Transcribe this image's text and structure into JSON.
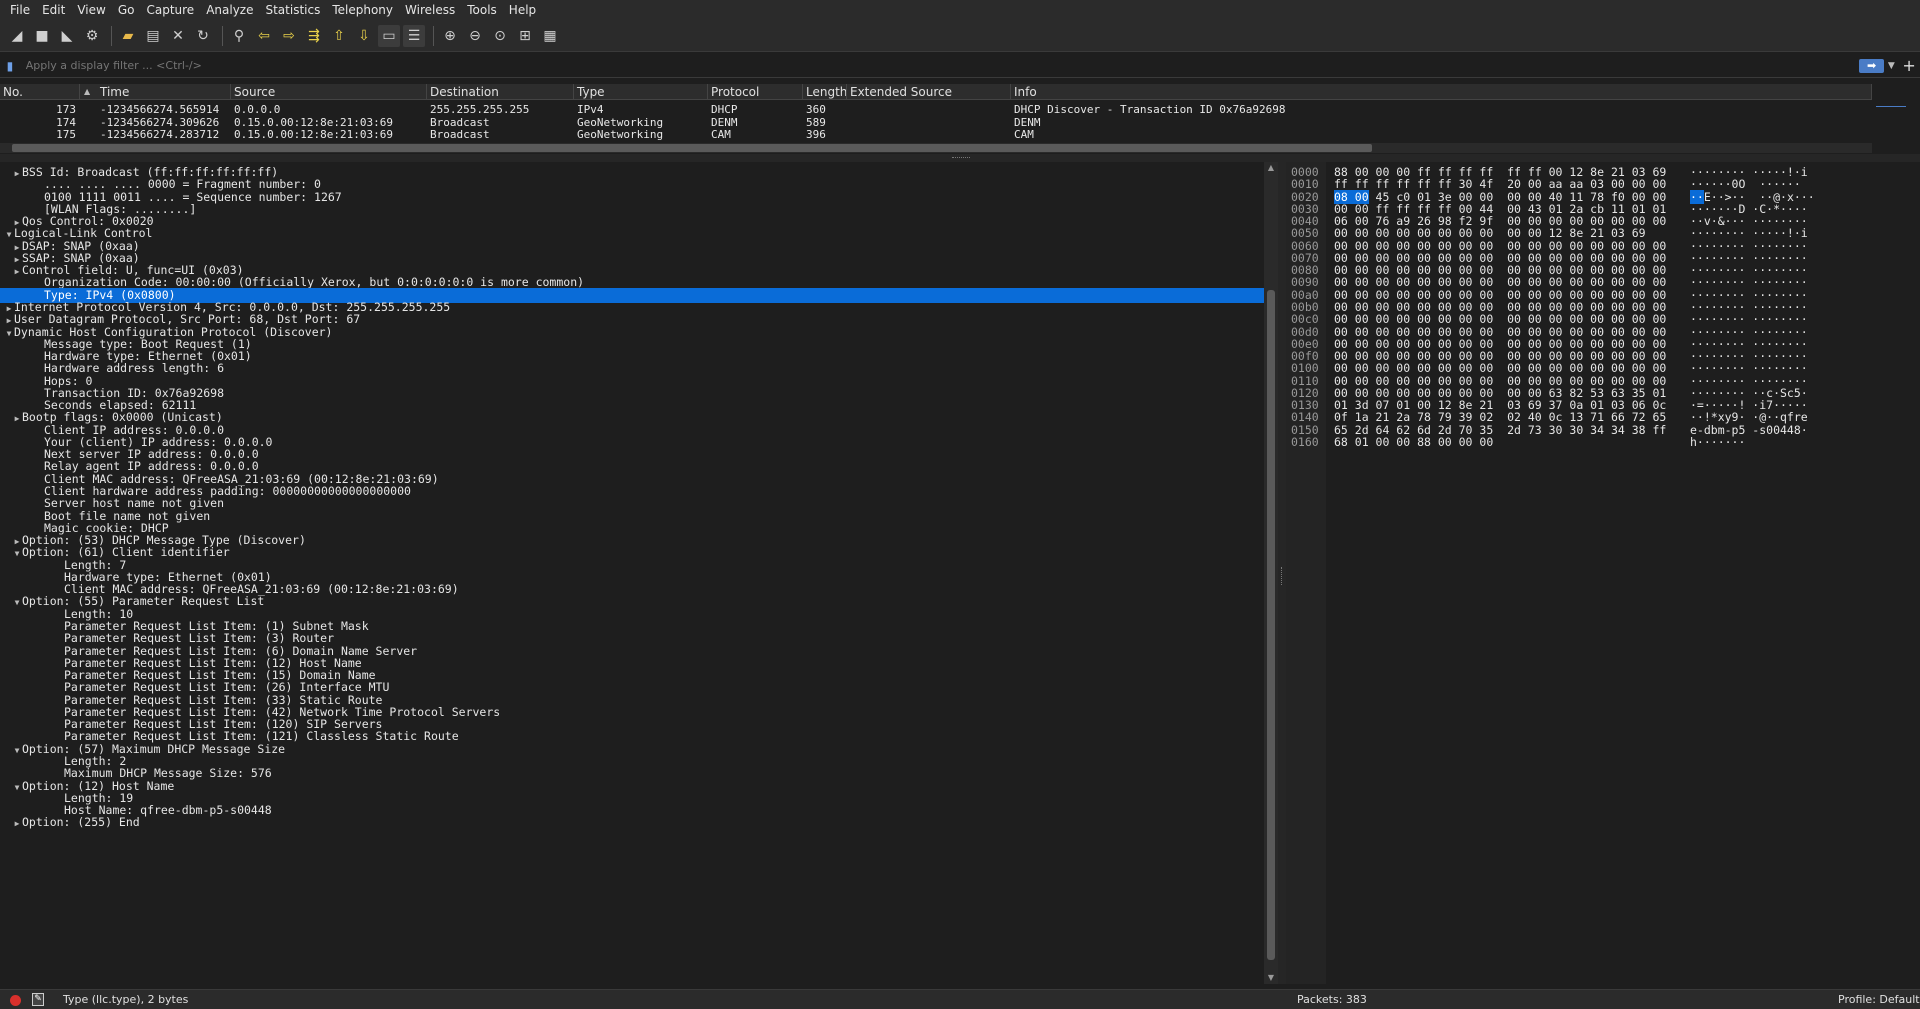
{
  "menu": [
    "File",
    "Edit",
    "View",
    "Go",
    "Capture",
    "Analyze",
    "Statistics",
    "Telephony",
    "Wireless",
    "Tools",
    "Help"
  ],
  "toolbar_icons": [
    "start-capture-icon",
    "stop-capture-icon",
    "restart-capture-icon",
    "capture-options-icon",
    "open-file-icon",
    "save-file-icon",
    "close-file-icon",
    "reload-file-icon",
    "find-packet-icon",
    "go-back-icon",
    "go-forward-icon",
    "go-to-packet-icon",
    "go-first-icon",
    "go-last-icon",
    "autoscroll-icon",
    "colorize-icon",
    "zoom-in-icon",
    "zoom-out-icon",
    "zoom-normal-icon",
    "resize-columns-icon",
    "layout-icon"
  ],
  "filter": {
    "placeholder": "Apply a display filter ... <Ctrl-/>"
  },
  "packet_list": {
    "columns": [
      "No.",
      "Time",
      "Source",
      "Destination",
      "Type",
      "Protocol",
      "Length",
      "Extended Source",
      "Info"
    ],
    "rows": [
      {
        "no": "173",
        "time": "-1234566274.565914",
        "source": "0.0.0.0",
        "destination": "255.255.255.255",
        "type": "IPv4",
        "protocol": "DHCP",
        "length": "360",
        "ext_source": "",
        "info": "DHCP Discover - Transaction ID 0x76a92698"
      },
      {
        "no": "174",
        "time": "-1234566274.309626",
        "source": "0.15.0.00:12:8e:21:03:69",
        "destination": "Broadcast",
        "type": "GeoNetworking",
        "protocol": "DENM",
        "length": "589",
        "ext_source": "",
        "info": "DENM"
      },
      {
        "no": "175",
        "time": "-1234566274.283712",
        "source": "0.15.0.00:12:8e:21:03:69",
        "destination": "Broadcast",
        "type": "GeoNetworking",
        "protocol": "CAM",
        "length": "396",
        "ext_source": "",
        "info": "CAM"
      }
    ]
  },
  "tree": [
    {
      "indent": 1,
      "arrow": "collapsed",
      "text": "BSS Id: Broadcast (ff:ff:ff:ff:ff:ff)"
    },
    {
      "indent": 2,
      "arrow": "",
      "text": ".... .... .... 0000 = Fragment number: 0"
    },
    {
      "indent": 2,
      "arrow": "",
      "text": "0100 1111 0011 .... = Sequence number: 1267"
    },
    {
      "indent": 2,
      "arrow": "",
      "text": "[WLAN Flags: ........]"
    },
    {
      "indent": 1,
      "arrow": "collapsed",
      "text": "Qos Control: 0x0020"
    },
    {
      "indent": 0,
      "arrow": "expanded",
      "text": "Logical-Link Control"
    },
    {
      "indent": 1,
      "arrow": "collapsed",
      "text": "DSAP: SNAP (0xaa)"
    },
    {
      "indent": 1,
      "arrow": "collapsed",
      "text": "SSAP: SNAP (0xaa)"
    },
    {
      "indent": 1,
      "arrow": "collapsed",
      "text": "Control field: U, func=UI (0x03)"
    },
    {
      "indent": 2,
      "arrow": "",
      "text": "Organization Code: 00:00:00 (Officially Xerox, but 0:0:0:0:0:0 is more common)"
    },
    {
      "indent": 2,
      "arrow": "",
      "text": "Type: IPv4 (0x0800)",
      "selected": true
    },
    {
      "indent": 0,
      "arrow": "collapsed",
      "text": "Internet Protocol Version 4, Src: 0.0.0.0, Dst: 255.255.255.255"
    },
    {
      "indent": 0,
      "arrow": "collapsed",
      "text": "User Datagram Protocol, Src Port: 68, Dst Port: 67"
    },
    {
      "indent": 0,
      "arrow": "expanded",
      "text": "Dynamic Host Configuration Protocol (Discover)"
    },
    {
      "indent": 2,
      "arrow": "",
      "text": "Message type: Boot Request (1)"
    },
    {
      "indent": 2,
      "arrow": "",
      "text": "Hardware type: Ethernet (0x01)"
    },
    {
      "indent": 2,
      "arrow": "",
      "text": "Hardware address length: 6"
    },
    {
      "indent": 2,
      "arrow": "",
      "text": "Hops: 0"
    },
    {
      "indent": 2,
      "arrow": "",
      "text": "Transaction ID: 0x76a92698"
    },
    {
      "indent": 2,
      "arrow": "",
      "text": "Seconds elapsed: 62111"
    },
    {
      "indent": 1,
      "arrow": "collapsed",
      "text": "Bootp flags: 0x0000 (Unicast)"
    },
    {
      "indent": 2,
      "arrow": "",
      "text": "Client IP address: 0.0.0.0"
    },
    {
      "indent": 2,
      "arrow": "",
      "text": "Your (client) IP address: 0.0.0.0"
    },
    {
      "indent": 2,
      "arrow": "",
      "text": "Next server IP address: 0.0.0.0"
    },
    {
      "indent": 2,
      "arrow": "",
      "text": "Relay agent IP address: 0.0.0.0"
    },
    {
      "indent": 2,
      "arrow": "",
      "text": "Client MAC address: QFreeASA_21:03:69 (00:12:8e:21:03:69)"
    },
    {
      "indent": 2,
      "arrow": "",
      "text": "Client hardware address padding: 00000000000000000000"
    },
    {
      "indent": 2,
      "arrow": "",
      "text": "Server host name not given"
    },
    {
      "indent": 2,
      "arrow": "",
      "text": "Boot file name not given"
    },
    {
      "indent": 2,
      "arrow": "",
      "text": "Magic cookie: DHCP"
    },
    {
      "indent": 1,
      "arrow": "collapsed",
      "text": "Option: (53) DHCP Message Type (Discover)"
    },
    {
      "indent": 1,
      "arrow": "expanded",
      "text": "Option: (61) Client identifier"
    },
    {
      "indent": 3,
      "arrow": "",
      "text": "Length: 7"
    },
    {
      "indent": 3,
      "arrow": "",
      "text": "Hardware type: Ethernet (0x01)"
    },
    {
      "indent": 3,
      "arrow": "",
      "text": "Client MAC address: QFreeASA_21:03:69 (00:12:8e:21:03:69)"
    },
    {
      "indent": 1,
      "arrow": "expanded",
      "text": "Option: (55) Parameter Request List"
    },
    {
      "indent": 3,
      "arrow": "",
      "text": "Length: 10"
    },
    {
      "indent": 3,
      "arrow": "",
      "text": "Parameter Request List Item: (1) Subnet Mask"
    },
    {
      "indent": 3,
      "arrow": "",
      "text": "Parameter Request List Item: (3) Router"
    },
    {
      "indent": 3,
      "arrow": "",
      "text": "Parameter Request List Item: (6) Domain Name Server"
    },
    {
      "indent": 3,
      "arrow": "",
      "text": "Parameter Request List Item: (12) Host Name"
    },
    {
      "indent": 3,
      "arrow": "",
      "text": "Parameter Request List Item: (15) Domain Name"
    },
    {
      "indent": 3,
      "arrow": "",
      "text": "Parameter Request List Item: (26) Interface MTU"
    },
    {
      "indent": 3,
      "arrow": "",
      "text": "Parameter Request List Item: (33) Static Route"
    },
    {
      "indent": 3,
      "arrow": "",
      "text": "Parameter Request List Item: (42) Network Time Protocol Servers"
    },
    {
      "indent": 3,
      "arrow": "",
      "text": "Parameter Request List Item: (120) SIP Servers"
    },
    {
      "indent": 3,
      "arrow": "",
      "text": "Parameter Request List Item: (121) Classless Static Route"
    },
    {
      "indent": 1,
      "arrow": "expanded",
      "text": "Option: (57) Maximum DHCP Message Size"
    },
    {
      "indent": 3,
      "arrow": "",
      "text": "Length: 2"
    },
    {
      "indent": 3,
      "arrow": "",
      "text": "Maximum DHCP Message Size: 576"
    },
    {
      "indent": 1,
      "arrow": "expanded",
      "text": "Option: (12) Host Name"
    },
    {
      "indent": 3,
      "arrow": "",
      "text": "Length: 19"
    },
    {
      "indent": 3,
      "arrow": "",
      "text": "Host Name: qfree-dbm-p5-s00448"
    },
    {
      "indent": 1,
      "arrow": "collapsed",
      "text": "Option: (255) End"
    }
  ],
  "bytes": [
    {
      "off": "0000",
      "hex": "88 00 00 00 ff ff ff ff  ff ff 00 12 8e 21 03 69",
      "ascii": "········ ·····!·i"
    },
    {
      "off": "0010",
      "hex": "ff ff ff ff ff ff 30 4f  20 00 aa aa 03 00 00 00",
      "ascii": "······0O  ······"
    },
    {
      "off": "0020",
      "hex_pre": "",
      "hex_hl": "08 00",
      "hex_post": " 45 c0 01 3e 00 00  00 00 40 11 78 f0 00 00",
      "ascii_hl": "··",
      "ascii_post": "E··>··  ··@·x···"
    },
    {
      "off": "0030",
      "hex": "00 00 ff ff ff ff 00 44  00 43 01 2a cb 11 01 01",
      "ascii": "·······D ·C·*····"
    },
    {
      "off": "0040",
      "hex": "06 00 76 a9 26 98 f2 9f  00 00 00 00 00 00 00 00",
      "ascii": "··v·&··· ········"
    },
    {
      "off": "0050",
      "hex": "00 00 00 00 00 00 00 00  00 00 12 8e 21 03 69",
      "ascii": "········ ·····!·i"
    },
    {
      "off": "0060",
      "hex": "00 00 00 00 00 00 00 00  00 00 00 00 00 00 00 00",
      "ascii": "········ ········"
    },
    {
      "off": "0070",
      "hex": "00 00 00 00 00 00 00 00  00 00 00 00 00 00 00 00",
      "ascii": "········ ········"
    },
    {
      "off": "0080",
      "hex": "00 00 00 00 00 00 00 00  00 00 00 00 00 00 00 00",
      "ascii": "········ ········"
    },
    {
      "off": "0090",
      "hex": "00 00 00 00 00 00 00 00  00 00 00 00 00 00 00 00",
      "ascii": "········ ········"
    },
    {
      "off": "00a0",
      "hex": "00 00 00 00 00 00 00 00  00 00 00 00 00 00 00 00",
      "ascii": "········ ········"
    },
    {
      "off": "00b0",
      "hex": "00 00 00 00 00 00 00 00  00 00 00 00 00 00 00 00",
      "ascii": "········ ········"
    },
    {
      "off": "00c0",
      "hex": "00 00 00 00 00 00 00 00  00 00 00 00 00 00 00 00",
      "ascii": "········ ········"
    },
    {
      "off": "00d0",
      "hex": "00 00 00 00 00 00 00 00  00 00 00 00 00 00 00 00",
      "ascii": "········ ········"
    },
    {
      "off": "00e0",
      "hex": "00 00 00 00 00 00 00 00  00 00 00 00 00 00 00 00",
      "ascii": "········ ········"
    },
    {
      "off": "00f0",
      "hex": "00 00 00 00 00 00 00 00  00 00 00 00 00 00 00 00",
      "ascii": "········ ········"
    },
    {
      "off": "0100",
      "hex": "00 00 00 00 00 00 00 00  00 00 00 00 00 00 00 00",
      "ascii": "········ ········"
    },
    {
      "off": "0110",
      "hex": "00 00 00 00 00 00 00 00  00 00 00 00 00 00 00 00",
      "ascii": "········ ········"
    },
    {
      "off": "0120",
      "hex": "00 00 00 00 00 00 00 00  00 00 63 82 53 63 35 01",
      "ascii": "········ ··c·Sc5·"
    },
    {
      "off": "0130",
      "hex": "01 3d 07 01 00 12 8e 21  03 69 37 0a 01 03 06 0c",
      "ascii": "·=·····! ·i7·····"
    },
    {
      "off": "0140",
      "hex": "0f 1a 21 2a 78 79 39 02  02 40 0c 13 71 66 72 65",
      "ascii": "··!*xy9· ·@··qfre"
    },
    {
      "off": "0150",
      "hex": "65 2d 64 62 6d 2d 70 35  2d 73 30 30 34 34 38 ff",
      "ascii": "e-dbm-p5 -s00448·"
    },
    {
      "off": "0160",
      "hex": "68 01 00 00 88 00 00 00",
      "ascii": "h·······"
    }
  ],
  "status": {
    "field_text": "Type (llc.type), 2 bytes",
    "packets": "Packets: 383",
    "profile": "Profile: Default"
  },
  "colors": {
    "selection": "#0a6cd8",
    "background": "#1e1e1e"
  }
}
